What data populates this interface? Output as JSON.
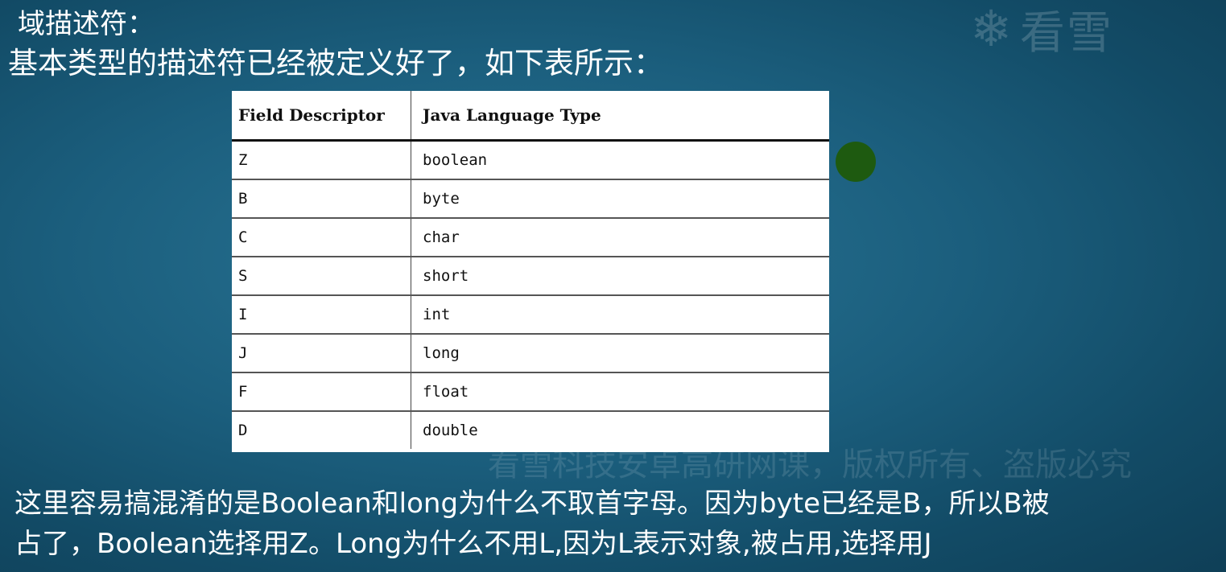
{
  "heading": {
    "line1": "域描述符：",
    "line2": "基本类型的描述符已经被定义好了，如下表所示："
  },
  "watermark": {
    "logo_text": "看雪",
    "logo_icon": "snowflake-icon",
    "overlay_text": "看雪科技安卓高研网课，版权所有、盗版必究"
  },
  "table": {
    "headers": [
      "Field Descriptor",
      "Java Language Type"
    ],
    "rows": [
      [
        "Z",
        "boolean"
      ],
      [
        "B",
        "byte"
      ],
      [
        "C",
        "char"
      ],
      [
        "S",
        "short"
      ],
      [
        "I",
        "int"
      ],
      [
        "J",
        "long"
      ],
      [
        "F",
        "float"
      ],
      [
        "D",
        "double"
      ]
    ]
  },
  "pointer": {
    "color": "#1e5a10"
  },
  "explanation": {
    "line1": "这里容易搞混淆的是Boolean和long为什么不取首字母。因为byte已经是B，所以B被",
    "line2": "占了，Boolean选择用Z。Long为什么不用L,因为L表示对象,被占用,选择用J"
  },
  "colors": {
    "background": "#1b5e7d",
    "text": "#ffffff",
    "table_bg": "#ffffff"
  }
}
